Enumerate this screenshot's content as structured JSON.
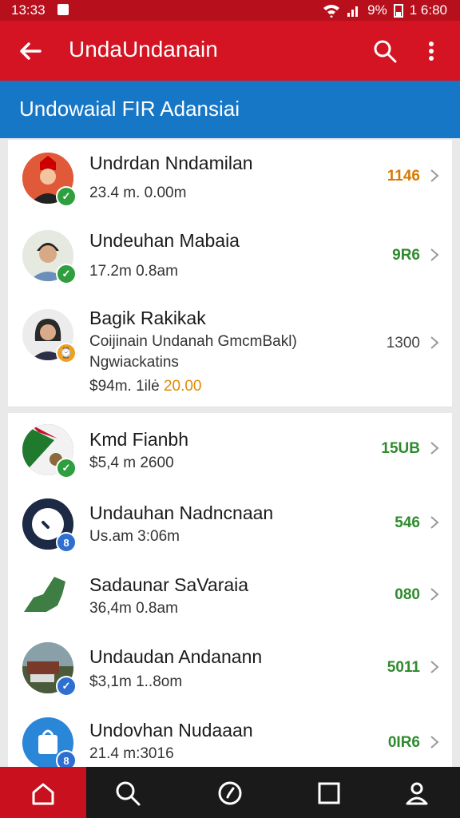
{
  "status": {
    "time": "13:33",
    "battery_pct": "9%",
    "clock": "1 6:80"
  },
  "appbar": {
    "title": "UndaUndanain"
  },
  "banner": {
    "text": "Undowaial FIR Adansiai"
  },
  "items": [
    {
      "name": "Undrdan Nndamilan",
      "sub1": "23.4 m. 0.00m",
      "value": "1146",
      "value_color": "#d97a00",
      "badge": "check-green"
    },
    {
      "name": "Undeuhan Mabaia",
      "sub1": "17.2m 0.8am",
      "value": "9R6",
      "value_color": "#2e8b2e",
      "badge": "check-green"
    },
    {
      "name": "Bagik Rakikak",
      "sub1": "Coijinain Undanah GmcmBakl)",
      "sub2": "Ngwiackatins",
      "sub3": "$94m. 1ilė",
      "sub3_accent": "20.00",
      "value": "1300",
      "value_color": "#444444",
      "badge": "clock-orange"
    },
    {
      "name": "Kmd Fianbh",
      "sub1": "$5,4 m 2600",
      "value": "15UB",
      "value_color": "#2e8b2e",
      "badge": "check-green"
    },
    {
      "name": "Undauhan Nadncnaan",
      "sub1": "Us.am 3:06m",
      "value": "546",
      "value_color": "#2e8b2e",
      "badge": "blue-square"
    },
    {
      "name": "Sadaunar SaVaraia",
      "sub1": "36,4m 0.8am",
      "value": "080",
      "value_color": "#2e8b2e",
      "badge": "none"
    },
    {
      "name": "Undaudan Andanann",
      "sub1": "$3,1m 1..8om",
      "value": "5011",
      "value_color": "#2e8b2e",
      "badge": "check-blue"
    },
    {
      "name": "Undovhan Nudaaan",
      "sub1": "21.4 m:3016",
      "value": "0IR6",
      "value_color": "#2e8b2e",
      "badge": "blue-square"
    }
  ],
  "nav": [
    {
      "icon": "home-icon",
      "active": true
    },
    {
      "icon": "search-icon",
      "active": false
    },
    {
      "icon": "compass-icon",
      "active": false
    },
    {
      "icon": "square-icon",
      "active": false
    },
    {
      "icon": "profile-icon",
      "active": false
    }
  ]
}
